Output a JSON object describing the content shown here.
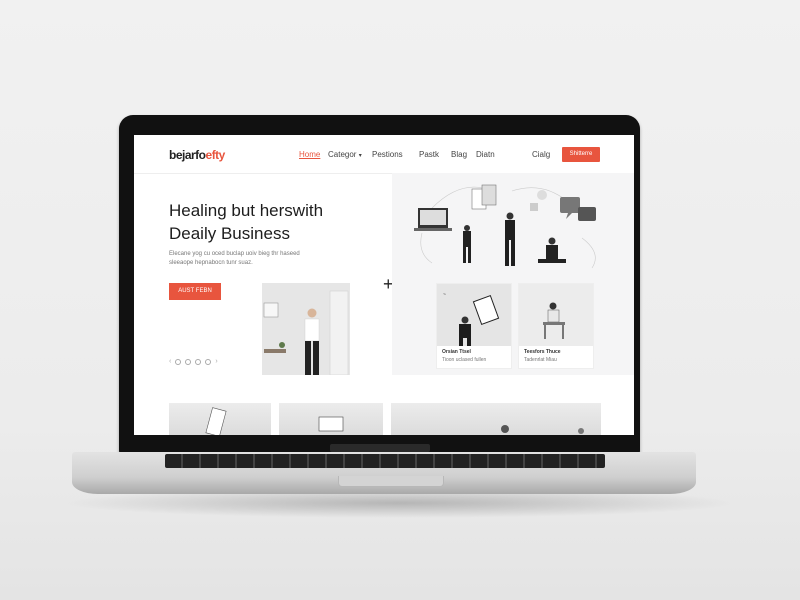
{
  "site": {
    "logo_main": "bejarfo",
    "logo_accent": "efty"
  },
  "nav": {
    "items": [
      {
        "label": "Home",
        "active": true
      },
      {
        "label": "Categor",
        "active": false
      },
      {
        "label": "Pestions",
        "active": false
      },
      {
        "label": "Pastk",
        "active": false
      },
      {
        "label": "Blag",
        "active": false
      },
      {
        "label": "Diatn",
        "active": false
      },
      {
        "label": "Cialg",
        "active": false
      }
    ],
    "cta_label": "Shitterre"
  },
  "hero": {
    "title_line1": "Healing but herswith",
    "title_line2": "Deaily Business",
    "description": "Elecane yog cu oced buclap uoiv bieg thr haseed sleeaope hepnabocn tunr suaz.",
    "cta_label": "AUST FEBN"
  },
  "cards": [
    {
      "title": "Orsian Ttsel",
      "subtitle": "Tioon uclased fullen"
    },
    {
      "title": "Teesfors Thuce",
      "subtitle": "Tadenrlat Miau"
    }
  ],
  "colors": {
    "accent": "#e8553e",
    "text": "#1d1d1d",
    "lid": "#111111"
  },
  "icons": [
    "plus-icon",
    "laptop-icon",
    "chat-bubble-icon",
    "document-icon"
  ]
}
